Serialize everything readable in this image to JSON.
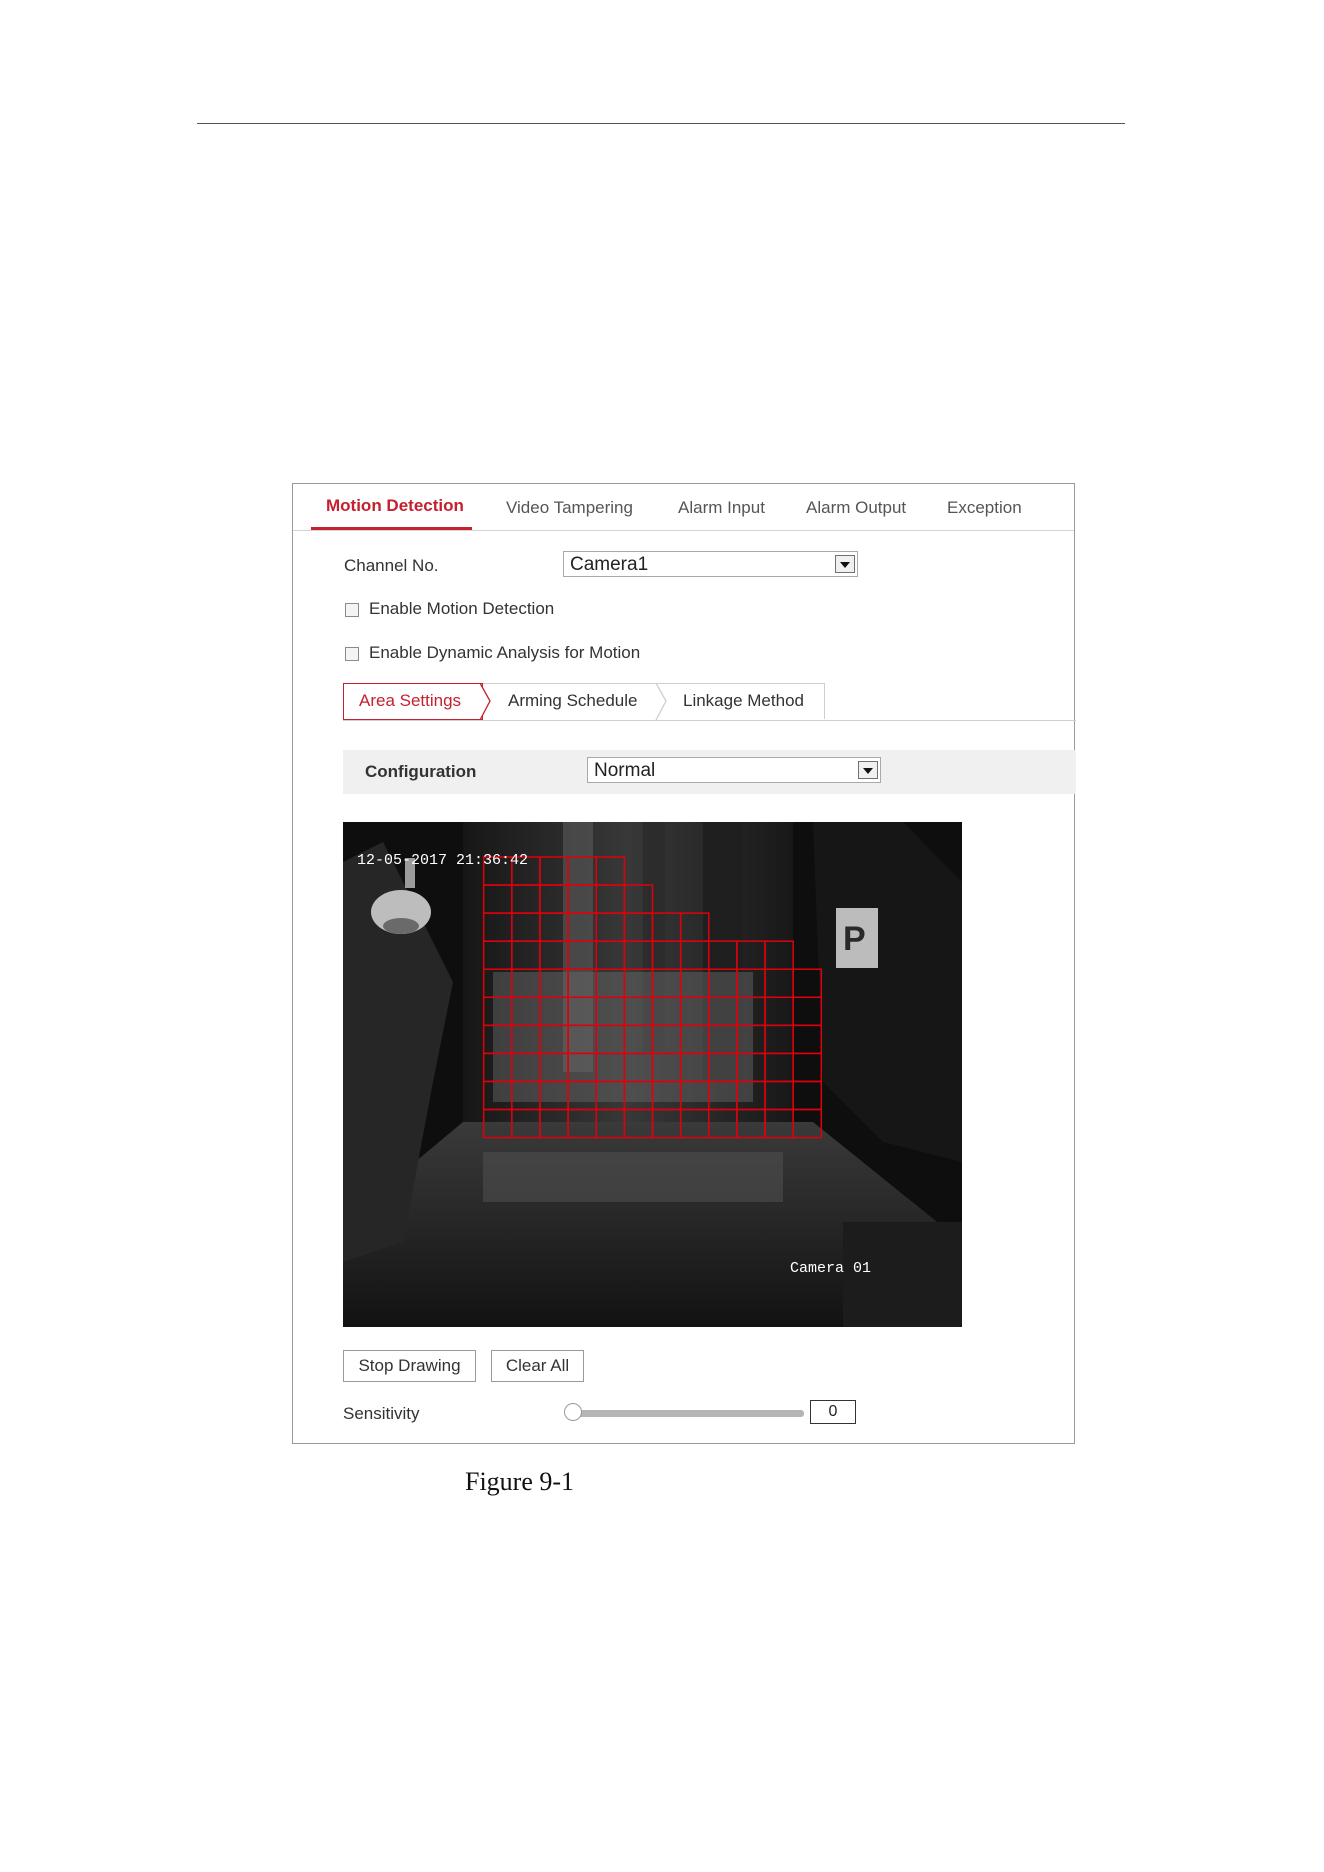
{
  "tabs": [
    {
      "label": "Motion Detection",
      "active": true
    },
    {
      "label": "Video Tampering",
      "active": false
    },
    {
      "label": "Alarm Input",
      "active": false
    },
    {
      "label": "Alarm Output",
      "active": false
    },
    {
      "label": "Exception",
      "active": false
    }
  ],
  "channel": {
    "label": "Channel No.",
    "value": "Camera1"
  },
  "checkboxes": {
    "motion": {
      "label": "Enable Motion Detection",
      "checked": false
    },
    "dynamic": {
      "label": "Enable Dynamic Analysis for Motion",
      "checked": false
    }
  },
  "subtabs": [
    {
      "label": "Area Settings",
      "active": true
    },
    {
      "label": "Arming Schedule",
      "active": false
    },
    {
      "label": "Linkage Method",
      "active": false
    }
  ],
  "configuration": {
    "label": "Configuration",
    "value": "Normal"
  },
  "video": {
    "timestamp": "12-05-2017 21:36:42",
    "camera_name": "Camera 01",
    "grid_color": "#e0000d",
    "grid_cols": 22,
    "grid_rows": 18,
    "selected_rows": [
      "0000011111000000000000",
      "0000011111100000000000",
      "0000011111111000000000",
      "0000011111111111000000",
      "0000011111111111100000",
      "0000011111111111100000",
      "0000011111111111100000",
      "0000011111111111100000",
      "0000011111111111100000",
      "0000011111111111100000",
      "0000000000000000000000",
      "0000000000000000000000",
      "0000000000000000000000",
      "0000000000000000000000",
      "0000000000000000000000",
      "0000000000000000000000",
      "0000000000000000000000",
      "0000000000000000000000"
    ],
    "sign_letter": "P"
  },
  "buttons": {
    "stop_drawing": "Stop Drawing",
    "clear_all": "Clear All"
  },
  "sensitivity": {
    "label": "Sensitivity",
    "value": "0",
    "level": 0
  },
  "caption": "Figure 9-1",
  "colors": {
    "accent": "#c4202d"
  }
}
